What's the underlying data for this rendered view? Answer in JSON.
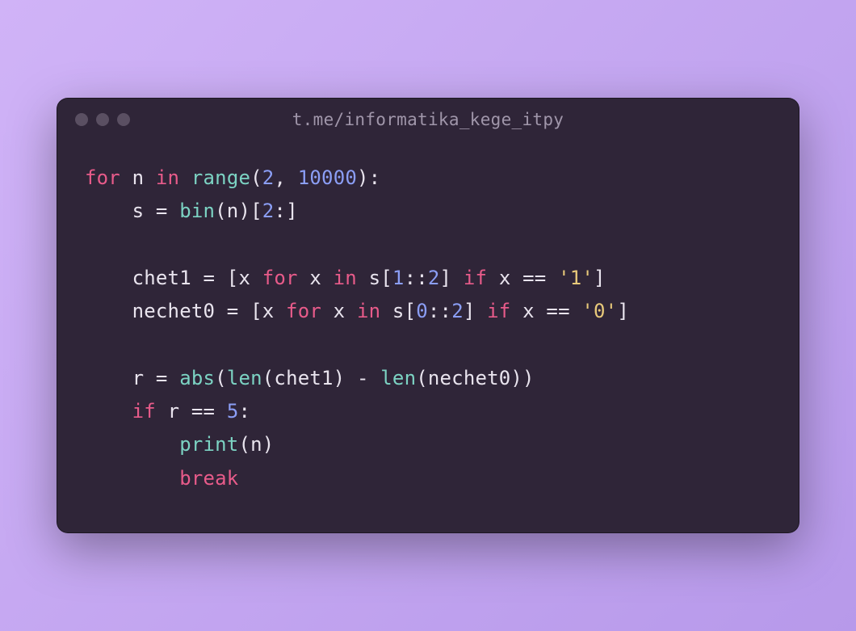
{
  "window": {
    "title": "t.me/informatika_kege_itpy"
  },
  "colors": {
    "bg_gradient_start": "#d0b3f7",
    "bg_gradient_end": "#b799ea",
    "window_bg": "#2f2538",
    "title_text": "#a096aa",
    "traffic_light": "#5a4f62",
    "code_default": "#e9e4ee",
    "code_keyword": "#e85b8a",
    "code_builtin": "#7cd3c3",
    "code_number": "#8b9ef5",
    "code_string": "#e8c97a"
  },
  "code": {
    "language": "python",
    "lines": [
      [
        {
          "t": "for",
          "c": "keyword"
        },
        {
          "t": " n ",
          "c": "default"
        },
        {
          "t": "in",
          "c": "keyword"
        },
        {
          "t": " ",
          "c": "default"
        },
        {
          "t": "range",
          "c": "builtin"
        },
        {
          "t": "(",
          "c": "punct"
        },
        {
          "t": "2",
          "c": "number"
        },
        {
          "t": ", ",
          "c": "punct"
        },
        {
          "t": "10000",
          "c": "number"
        },
        {
          "t": "):",
          "c": "punct"
        }
      ],
      [
        {
          "t": "    s = ",
          "c": "default"
        },
        {
          "t": "bin",
          "c": "builtin"
        },
        {
          "t": "(n)[",
          "c": "punct"
        },
        {
          "t": "2",
          "c": "number"
        },
        {
          "t": ":]",
          "c": "punct"
        }
      ],
      [],
      [
        {
          "t": "    chet1 = [x ",
          "c": "default"
        },
        {
          "t": "for",
          "c": "keyword"
        },
        {
          "t": " x ",
          "c": "default"
        },
        {
          "t": "in",
          "c": "keyword"
        },
        {
          "t": " s[",
          "c": "default"
        },
        {
          "t": "1",
          "c": "number"
        },
        {
          "t": "::",
          "c": "punct"
        },
        {
          "t": "2",
          "c": "number"
        },
        {
          "t": "] ",
          "c": "punct"
        },
        {
          "t": "if",
          "c": "keyword"
        },
        {
          "t": " x == ",
          "c": "default"
        },
        {
          "t": "'1'",
          "c": "string"
        },
        {
          "t": "]",
          "c": "punct"
        }
      ],
      [
        {
          "t": "    nechet0 = [x ",
          "c": "default"
        },
        {
          "t": "for",
          "c": "keyword"
        },
        {
          "t": " x ",
          "c": "default"
        },
        {
          "t": "in",
          "c": "keyword"
        },
        {
          "t": " s[",
          "c": "default"
        },
        {
          "t": "0",
          "c": "number"
        },
        {
          "t": "::",
          "c": "punct"
        },
        {
          "t": "2",
          "c": "number"
        },
        {
          "t": "] ",
          "c": "punct"
        },
        {
          "t": "if",
          "c": "keyword"
        },
        {
          "t": " x == ",
          "c": "default"
        },
        {
          "t": "'0'",
          "c": "string"
        },
        {
          "t": "]",
          "c": "punct"
        }
      ],
      [],
      [
        {
          "t": "    r = ",
          "c": "default"
        },
        {
          "t": "abs",
          "c": "builtin"
        },
        {
          "t": "(",
          "c": "punct"
        },
        {
          "t": "len",
          "c": "builtin"
        },
        {
          "t": "(chet1) - ",
          "c": "default"
        },
        {
          "t": "len",
          "c": "builtin"
        },
        {
          "t": "(nechet0))",
          "c": "default"
        }
      ],
      [
        {
          "t": "    ",
          "c": "default"
        },
        {
          "t": "if",
          "c": "keyword"
        },
        {
          "t": " r == ",
          "c": "default"
        },
        {
          "t": "5",
          "c": "number"
        },
        {
          "t": ":",
          "c": "punct"
        }
      ],
      [
        {
          "t": "        ",
          "c": "default"
        },
        {
          "t": "print",
          "c": "builtin"
        },
        {
          "t": "(n)",
          "c": "default"
        }
      ],
      [
        {
          "t": "        ",
          "c": "default"
        },
        {
          "t": "break",
          "c": "keyword"
        }
      ]
    ]
  }
}
